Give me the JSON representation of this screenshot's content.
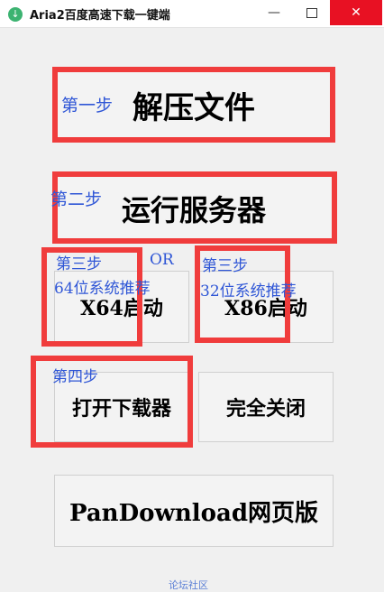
{
  "window": {
    "title": "Aria2百度高速下载一键端",
    "controls": {
      "minimize": "—",
      "close": "✕"
    }
  },
  "buttons": {
    "extract": "解压文件",
    "run_server": "运行服务器",
    "x64_start": "X64启动",
    "x86_start": "X86启动",
    "open_downloader": "打开下载器",
    "close_all": "完全关闭",
    "pandownload_web": "PanDownload网页版"
  },
  "annotations": {
    "step1": "第一步",
    "step2": "第二步",
    "step3_left": "第三步",
    "step3_left_sub": "64位系统推荐",
    "or": "OR",
    "step3_right": "第三步",
    "step3_right_sub": "32位系统推荐",
    "step4": "第四步"
  },
  "footer": {
    "link": "论坛社区"
  },
  "colors": {
    "highlight": "#f03c3c",
    "annotation": "#2f56d6",
    "close_button": "#e81123"
  },
  "icons": {
    "app": "download-circle-icon",
    "maximize": "maximize-icon"
  }
}
